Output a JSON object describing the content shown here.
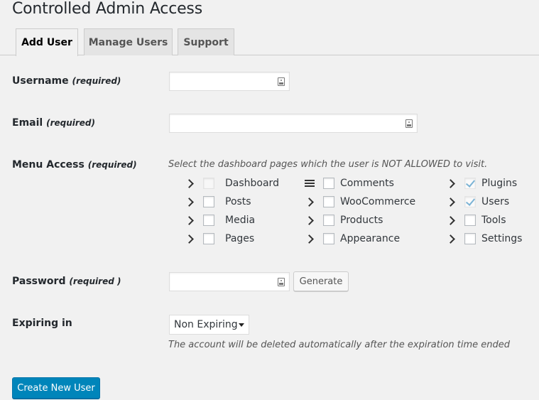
{
  "page_title": "Controlled Admin Access",
  "tabs": [
    {
      "label": "Add User",
      "active": true
    },
    {
      "label": "Manage Users",
      "active": false
    },
    {
      "label": "Support",
      "active": false
    }
  ],
  "form": {
    "username": {
      "label": "Username",
      "required": "(required)",
      "value": ""
    },
    "email": {
      "label": "Email",
      "required": "(required)",
      "value": ""
    },
    "menu_access": {
      "label": "Menu Access",
      "required": "(required)",
      "hint": "Select the dashboard pages which the user is NOT ALLOWED to visit.",
      "columns": [
        [
          {
            "label": "Dashboard",
            "icon": "chevron-right-icon",
            "checked": false,
            "disabled": true
          },
          {
            "label": "Posts",
            "icon": "chevron-right-icon",
            "checked": false,
            "disabled": false
          },
          {
            "label": "Media",
            "icon": "chevron-right-icon",
            "checked": false,
            "disabled": false
          },
          {
            "label": "Pages",
            "icon": "chevron-right-icon",
            "checked": false,
            "disabled": false
          }
        ],
        [
          {
            "label": "Comments",
            "icon": "menu-icon",
            "checked": false,
            "disabled": false
          },
          {
            "label": "WooCommerce",
            "icon": "chevron-right-icon",
            "checked": false,
            "disabled": false
          },
          {
            "label": "Products",
            "icon": "chevron-right-icon",
            "checked": false,
            "disabled": false
          },
          {
            "label": "Appearance",
            "icon": "chevron-right-icon",
            "checked": false,
            "disabled": false
          }
        ],
        [
          {
            "label": "Plugins",
            "icon": "chevron-right-icon",
            "checked": true,
            "disabled": true
          },
          {
            "label": "Users",
            "icon": "chevron-right-icon",
            "checked": true,
            "disabled": true
          },
          {
            "label": "Tools",
            "icon": "chevron-right-icon",
            "checked": false,
            "disabled": false
          },
          {
            "label": "Settings",
            "icon": "chevron-right-icon",
            "checked": false,
            "disabled": false
          }
        ]
      ]
    },
    "password": {
      "label": "Password",
      "required": "(required )",
      "value": "",
      "generate_label": "Generate"
    },
    "expiring": {
      "label": "Expiring in",
      "selected": "Non Expiring",
      "hint": "The account will be deleted automatically after the expiration time ended"
    },
    "submit_label": "Create New User"
  },
  "colors": {
    "primary_button": "#0085ba",
    "background": "#f1f1f1",
    "checkmark": "#7bb3d5"
  }
}
